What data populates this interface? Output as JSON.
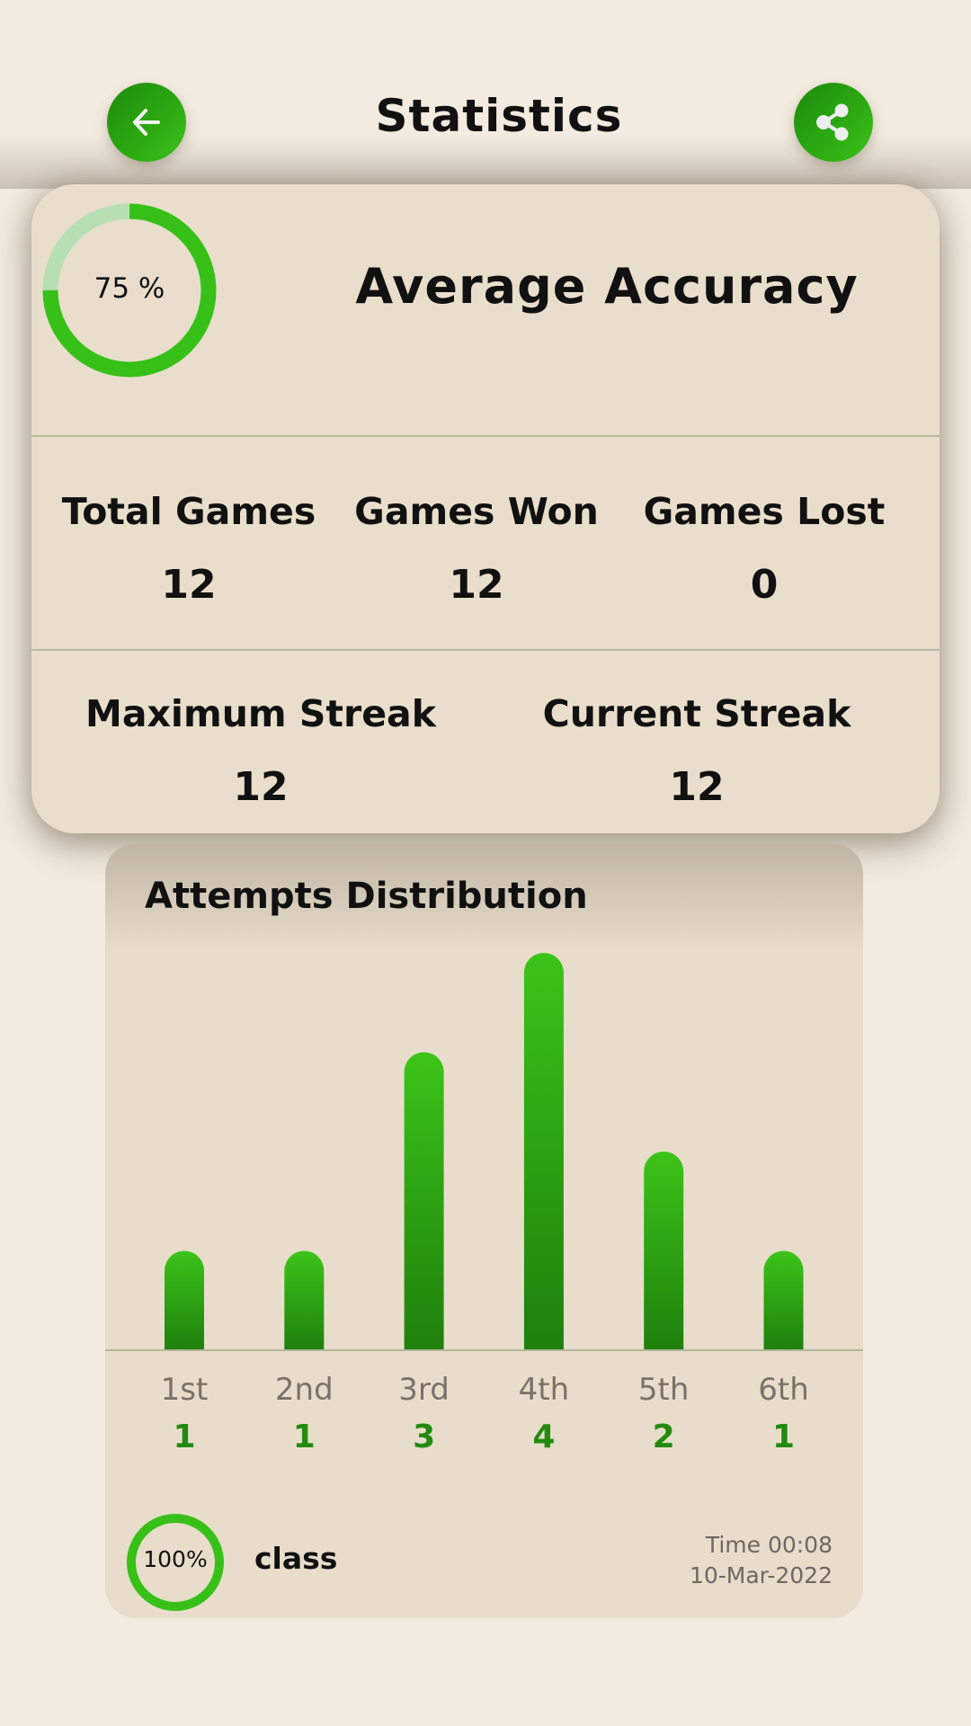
{
  "header": {
    "title": "Statistics",
    "back_icon": "arrow-left-icon",
    "share_icon": "share-icon"
  },
  "accuracy": {
    "percent_label": "75 %",
    "percent_value": 75,
    "title": "Average Accuracy"
  },
  "stats_row1": [
    {
      "label": "Total Games",
      "value": "12"
    },
    {
      "label": "Games Won",
      "value": "12"
    },
    {
      "label": "Games Lost",
      "value": "0"
    }
  ],
  "stats_row2": [
    {
      "label": "Maximum Streak",
      "value": "12"
    },
    {
      "label": "Current Streak",
      "value": "12"
    }
  ],
  "distribution": {
    "title": "Attempts Distribution"
  },
  "chart_data": {
    "type": "bar",
    "title": "Attempts Distribution",
    "categories": [
      "1st",
      "2nd",
      "3rd",
      "4th",
      "5th",
      "6th"
    ],
    "values": [
      1,
      1,
      3,
      4,
      2,
      1
    ],
    "value_labels": [
      "1",
      "1",
      "3",
      "4",
      "2",
      "1"
    ],
    "xlabel": "",
    "ylabel": "",
    "ylim": [
      0,
      4
    ],
    "grid": false,
    "legend": "none"
  },
  "last_game": {
    "percent_label": "100%",
    "percent_value": 100,
    "word": "class",
    "time": "Time 00:08",
    "date": "10-Mar-2022"
  },
  "colors": {
    "accent": "#37C018",
    "accent_dark": "#1E800C",
    "ring_track": "#B8DEB4",
    "background": "#F3EBDF",
    "card": "#E9DECB",
    "value_green": "#238A10"
  }
}
